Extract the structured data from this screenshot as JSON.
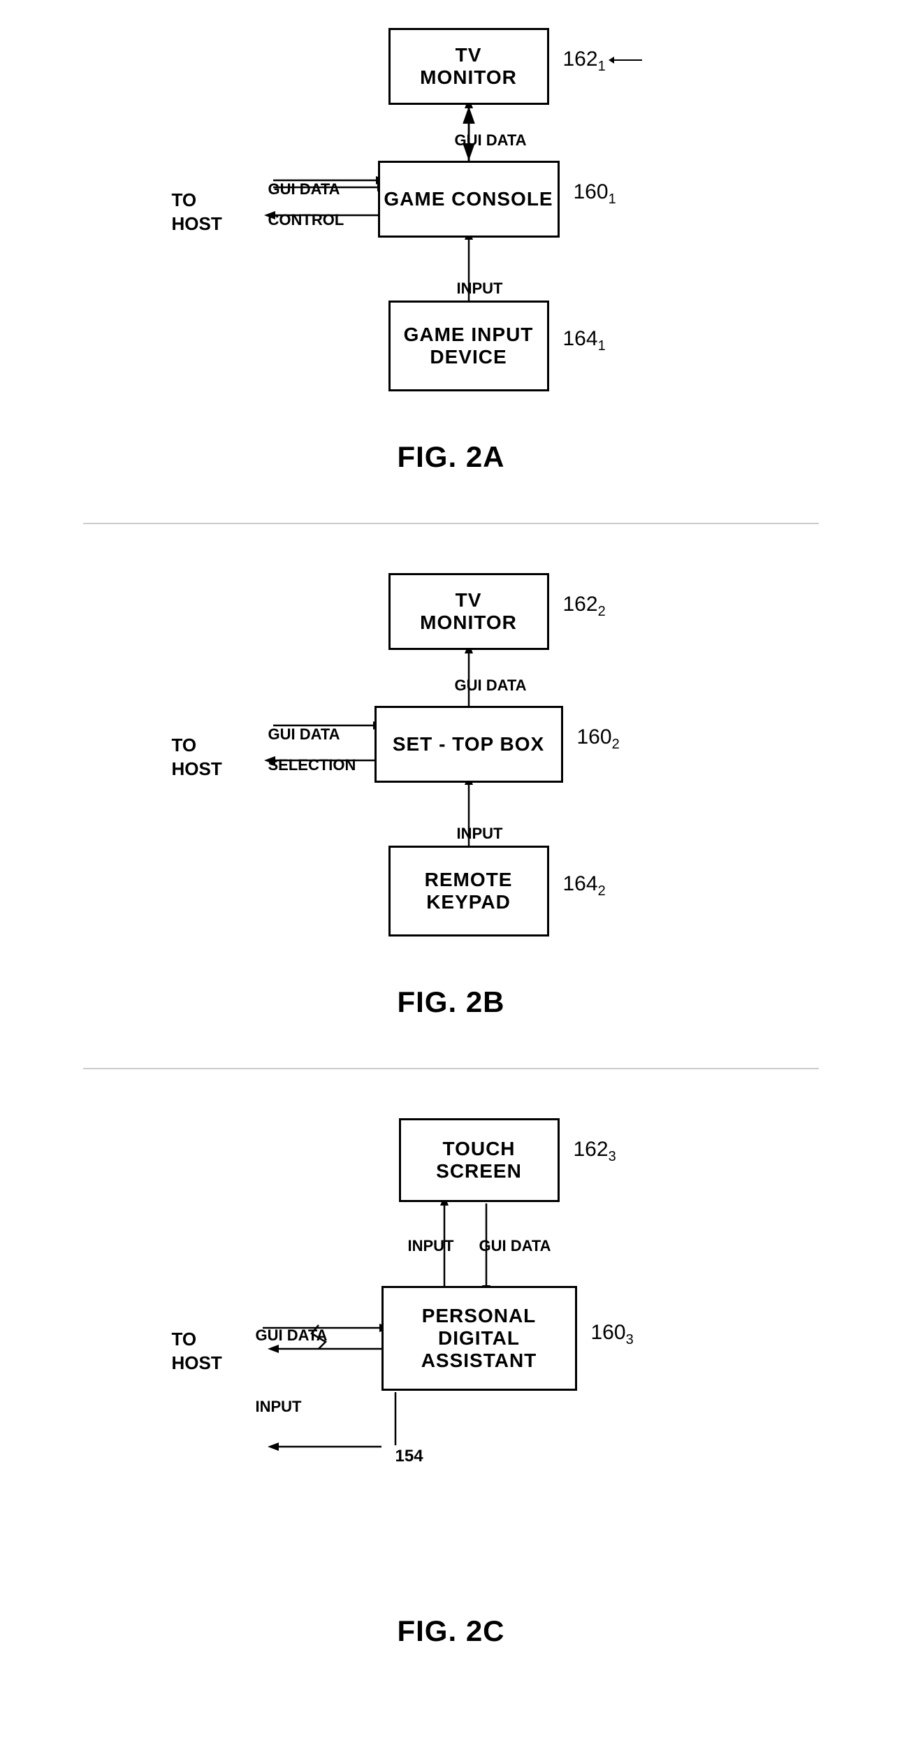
{
  "figures": {
    "fig2a": {
      "label": "FIG. 2A",
      "tv_monitor": "TV\nMONITOR",
      "game_console": "GAME CONSOLE",
      "game_input_device": "GAME INPUT\nDEVICE",
      "ref_162": "162",
      "ref_162_sub": "1",
      "ref_160": "160",
      "ref_160_sub": "1",
      "ref_164": "164",
      "ref_164_sub": "1",
      "to_host": "TO\nHOST",
      "gui_data_top": "GUI DATA",
      "gui_data_left": "GUI DATA",
      "control": "CONTROL",
      "input": "INPUT"
    },
    "fig2b": {
      "label": "FIG. 2B",
      "tv_monitor": "TV\nMONITOR",
      "set_top_box": "SET - TOP BOX",
      "remote_keypad": "REMOTE\nKEYPAD",
      "ref_162": "162",
      "ref_162_sub": "2",
      "ref_160": "160",
      "ref_160_sub": "2",
      "ref_164": "164",
      "ref_164_sub": "2",
      "to_host": "TO\nHOST",
      "gui_data_top": "GUI DATA",
      "gui_data_left": "GUI DATA",
      "selection": "SELECTION",
      "input": "INPUT"
    },
    "fig2c": {
      "label": "FIG. 2C",
      "touch_screen": "TOUCH\nSCREEN",
      "pda": "PERSONAL\nDIGITAL\nASSISTANT",
      "ref_162": "162",
      "ref_162_sub": "3",
      "ref_160": "160",
      "ref_160_sub": "3",
      "to_host": "TO\nHOST",
      "gui_data_left": "GUI DATA",
      "input_top": "INPUT",
      "gui_data_top": "GUI DATA",
      "input_left": "INPUT",
      "ref_154": "154"
    }
  }
}
